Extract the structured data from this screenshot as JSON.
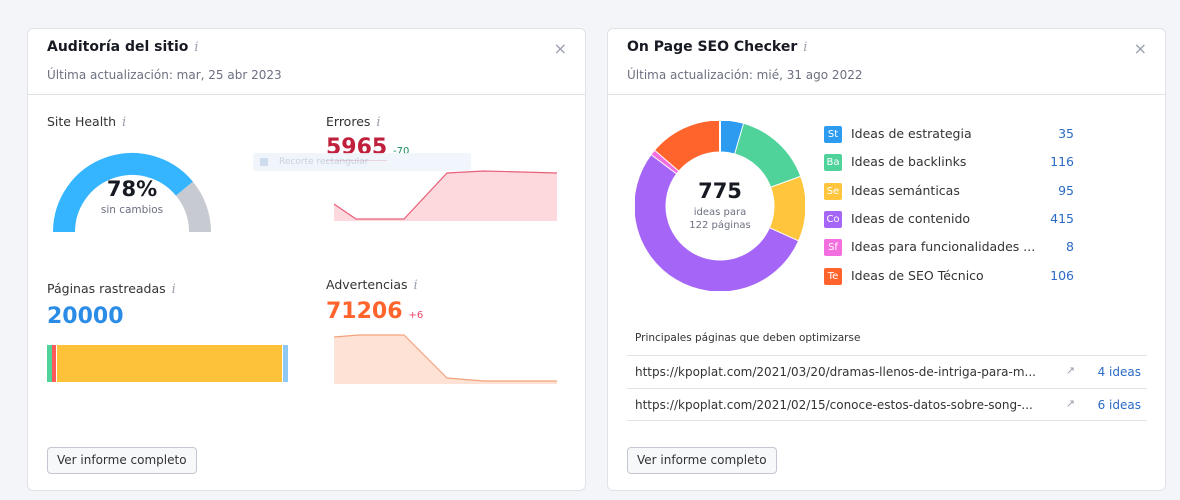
{
  "site_audit": {
    "title": "Auditoría del sitio",
    "info": "i",
    "close": "×",
    "updated": "Última actualización: mar, 25 abr 2023",
    "health_label": "Site Health",
    "health_value": "78%",
    "health_fraction": 0.78,
    "health_caption": "sin cambios",
    "errors_label": "Errores",
    "errors_value": "5965",
    "errors_delta": "-70",
    "tooltip_text": "Recorte rectangular",
    "pages_label": "Páginas rastreadas",
    "pages_value": "20000",
    "warnings_label": "Advertencias",
    "warnings_value": "71206",
    "warnings_delta": "+6",
    "button": "Ver informe completo",
    "colors": {
      "health": "#35b4ff",
      "health_rest": "#c8cad2",
      "errors": "#c0203c",
      "warnings": "#ff642d",
      "pages": "#2b8ce6"
    }
  },
  "seo_checker": {
    "title": "On Page SEO Checker",
    "info": "i",
    "close": "×",
    "updated": "Última actualización: mié, 31 ago 2022",
    "total": "775",
    "total_caption_1": "ideas para",
    "total_caption_2": "122 páginas",
    "legend": [
      {
        "tag": "St",
        "name": "Ideas de estrategia",
        "value": "35",
        "color": "#2d9cf0"
      },
      {
        "tag": "Ba",
        "name": "Ideas de backlinks",
        "value": "116",
        "color": "#4fd39b"
      },
      {
        "tag": "Se",
        "name": "Ideas semánticas",
        "value": "95",
        "color": "#ffc53d"
      },
      {
        "tag": "Co",
        "name": "Ideas de contenido",
        "value": "415",
        "color": "#a566f7"
      },
      {
        "tag": "Sf",
        "name": "Ideas para funcionalidades ...",
        "value": "8",
        "color": "#f36ede"
      },
      {
        "tag": "Te",
        "name": "Ideas de SEO Técnico",
        "value": "106",
        "color": "#ff642d"
      }
    ],
    "table_header": "Principales páginas que deben optimizarse",
    "rows": [
      {
        "url": "https://kpoplat.com/2021/03/20/dramas-llenos-de-intriga-para-m...",
        "ideas": "4 ideas"
      },
      {
        "url": "https://kpoplat.com/2021/02/15/conoce-estos-datos-sobre-song-...",
        "ideas": "6 ideas"
      }
    ],
    "ext_icon": "external-link-icon",
    "button": "Ver informe completo"
  }
}
